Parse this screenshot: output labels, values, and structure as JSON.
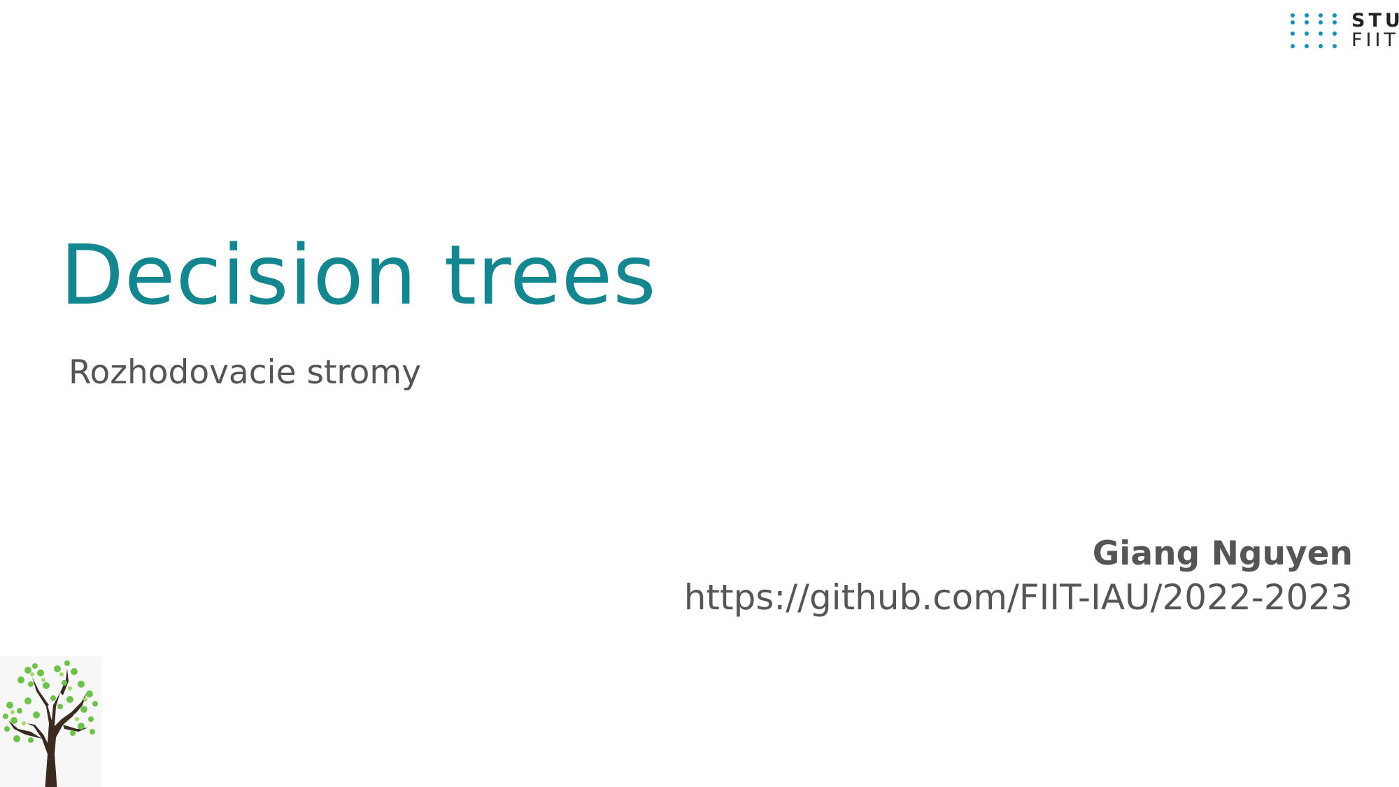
{
  "slide": {
    "title": "Decision trees",
    "subtitle": "Rozhodovacie stromy",
    "author": "Giang Nguyen",
    "url": "https://github.com/FIIT-IAU/2022-2023"
  },
  "logo": {
    "line1": "STU",
    "line2": "FIIT",
    "dot_color": "#1a8fb5"
  },
  "colors": {
    "title": "#13868f",
    "text": "#555555"
  },
  "icons": {
    "logo": "stu-fiit-logo",
    "illustration": "tree-illustration"
  }
}
